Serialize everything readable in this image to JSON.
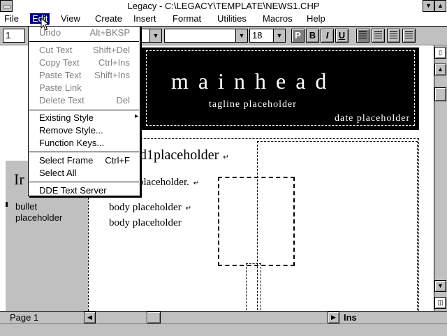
{
  "window": {
    "title": "Legacy - C:\\LEGACY\\TEMPLATE\\NEWS1.CHP"
  },
  "menubar": {
    "items": [
      {
        "label": "File"
      },
      {
        "label": "Edit"
      },
      {
        "label": "View"
      },
      {
        "label": "Create"
      },
      {
        "label": "Insert"
      },
      {
        "label": "Format"
      },
      {
        "label": "Utilities"
      },
      {
        "label": "Macros"
      },
      {
        "label": "Help"
      }
    ]
  },
  "toolbar": {
    "page_combo": "1",
    "size_combo": "18",
    "style_buttons": [
      "P",
      "B",
      "I",
      "U"
    ]
  },
  "edit_menu": {
    "items": [
      {
        "label": "Undo",
        "shortcut": "Alt+BKSP",
        "enabled": false
      },
      {
        "label": "Cut Text",
        "shortcut": "Shift+Del",
        "enabled": false
      },
      {
        "label": "Copy Text",
        "shortcut": "Ctrl+Ins",
        "enabled": false
      },
      {
        "label": "Paste Text",
        "shortcut": "Shift+Ins",
        "enabled": false
      },
      {
        "label": "Paste Link",
        "shortcut": "",
        "enabled": false
      },
      {
        "label": "Delete Text",
        "shortcut": "Del",
        "enabled": false
      },
      {
        "label": "Existing Style",
        "shortcut": "▸",
        "enabled": true
      },
      {
        "label": "Remove Style...",
        "shortcut": "",
        "enabled": true
      },
      {
        "label": "Function Keys...",
        "shortcut": "",
        "enabled": true
      },
      {
        "label": "Select Frame",
        "shortcut": "Ctrl+F",
        "enabled": true
      },
      {
        "label": "Select All",
        "shortcut": "",
        "enabled": true
      },
      {
        "label": "DDE Text Server",
        "shortcut": "",
        "enabled": true
      }
    ]
  },
  "document": {
    "mainhead": "mainhead",
    "tagline": "tagline placeholder",
    "date": "date placeholder",
    "head1": "d1placeholder",
    "head1_para": "placeholder.",
    "bullet": "bullet placeholder",
    "body1": "body placeholder",
    "body2": "body placeholder",
    "left_heading": "Ir"
  },
  "statusbar": {
    "page": "Page 1",
    "mode": "Ins"
  },
  "colors": {
    "menu_highlight": "#000080",
    "masthead_bg": "#000000",
    "chrome": "#c0c0c0"
  },
  "icons": [
    "system-menu-icon",
    "minimize-icon",
    "maximize-icon",
    "scroll-up-icon",
    "scroll-down-icon",
    "scroll-left-icon",
    "scroll-right-icon",
    "page-icon",
    "mouse-pointer-icon"
  ]
}
